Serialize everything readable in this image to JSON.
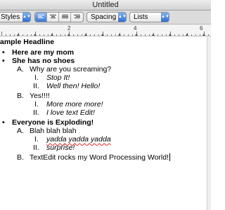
{
  "window": {
    "title": "Untitled"
  },
  "toolbar": {
    "styles_label": "Styles",
    "spacing_label": "Spacing",
    "lists_label": "Lists",
    "alignment": [
      "left",
      "center",
      "justify",
      "right"
    ],
    "selected_alignment": "left",
    "accent_color": "#2f6fd1"
  },
  "ruler": {
    "numbers": [
      "2",
      "4",
      "6"
    ]
  },
  "document": {
    "headline": "ample Headline",
    "lines": [
      {
        "marker": "•",
        "text": "Here are my mom"
      },
      {
        "marker": "•",
        "text": "She has no shoes"
      },
      {
        "marker": "A.",
        "text": "Why are you screaming?"
      },
      {
        "marker": "I.",
        "text": "Stop It!"
      },
      {
        "marker": "II.",
        "text": "Well then!  Hello!"
      },
      {
        "marker": "B.",
        "text": "Yes!!!!"
      },
      {
        "marker": "I.",
        "text": "More more more!"
      },
      {
        "marker": "II.",
        "text": "I love text Edit!"
      },
      {
        "marker": "•",
        "text": "Everyone is Exploding!"
      },
      {
        "marker": "A.",
        "text": "Blah blah blah"
      },
      {
        "marker": "I.",
        "text": "yadda yadda yadda"
      },
      {
        "marker": "II.",
        "text": "surprise!"
      },
      {
        "marker": "B.",
        "text": "TextEdit rocks my Word Processing World!"
      }
    ]
  }
}
